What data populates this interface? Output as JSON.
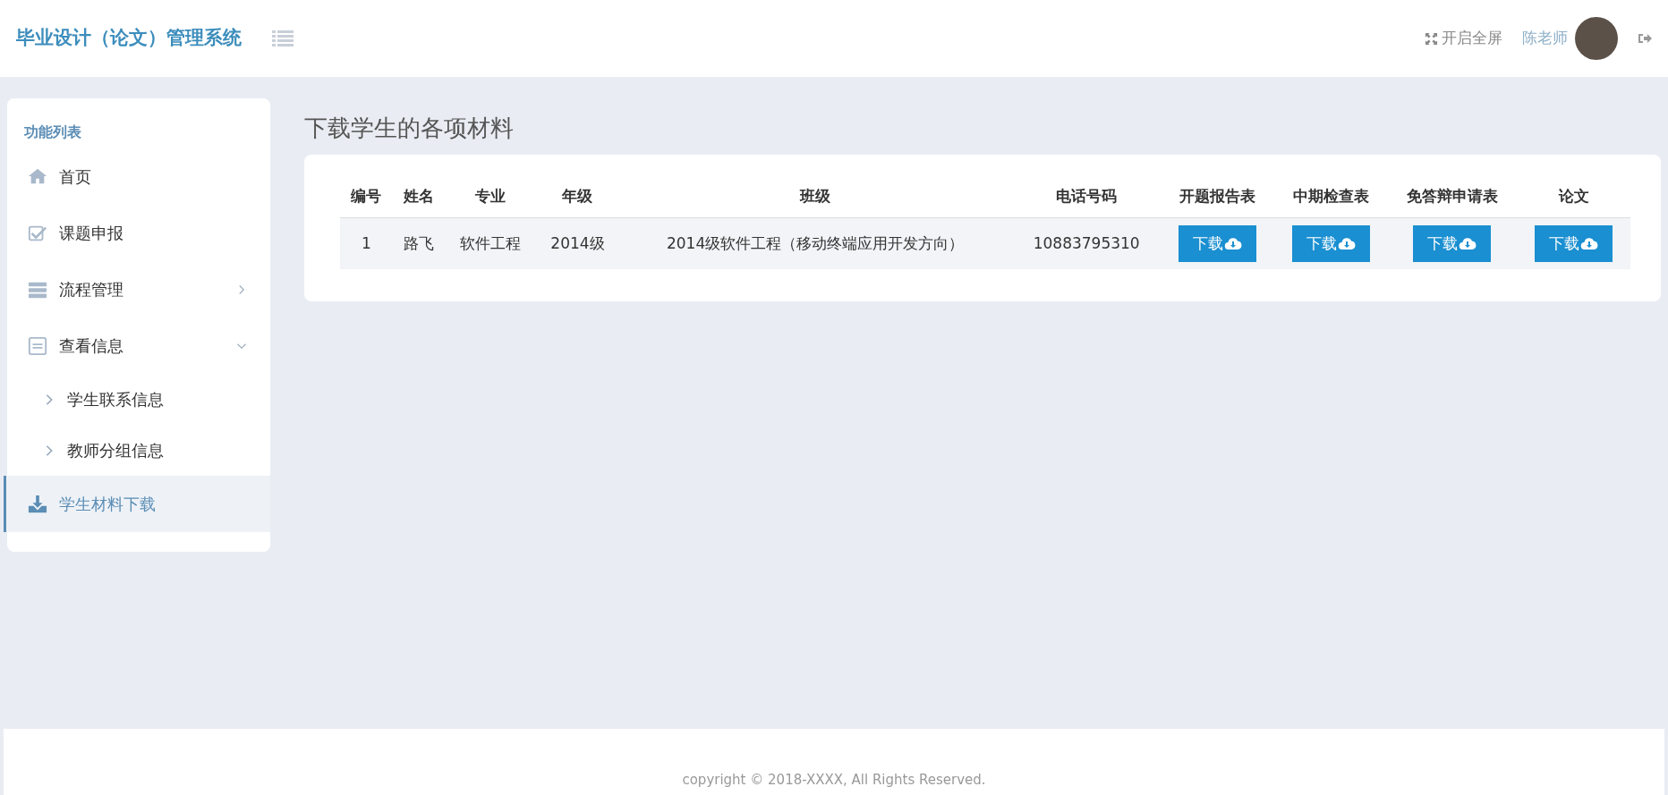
{
  "header": {
    "title": "毕业设计（论文）管理系统",
    "fullscreen": "开启全屏",
    "user": "陈老师"
  },
  "sidebar": {
    "heading": "功能列表",
    "items": [
      {
        "label": "首页",
        "selected": false
      },
      {
        "label": "课题申报",
        "selected": false
      },
      {
        "label": "流程管理",
        "selected": false,
        "expanded": false
      },
      {
        "label": "查看信息",
        "selected": false,
        "expanded": true,
        "children": [
          {
            "label": "学生联系信息",
            "selected": false
          },
          {
            "label": "教师分组信息",
            "selected": false
          }
        ]
      },
      {
        "label": "学生材料下载",
        "selected": true
      }
    ]
  },
  "page_title": "下载学生的各项材料",
  "table": {
    "columns": [
      "编号",
      "姓名",
      "专业",
      "年级",
      "班级",
      "电话号码",
      "开题报告表",
      "中期检查表",
      "免答辩申请表",
      "论文"
    ],
    "rows": [
      {
        "cells": [
          "1",
          "路飞",
          "软件工程",
          "2014级",
          "2014级软件工程（移动终端应用开发方向）",
          "10883795310"
        ],
        "downloads": [
          "下载",
          "下载",
          "下载",
          "下载"
        ]
      }
    ]
  },
  "footer": "copyright © 2018-XXXX, All Rights Reserved."
}
